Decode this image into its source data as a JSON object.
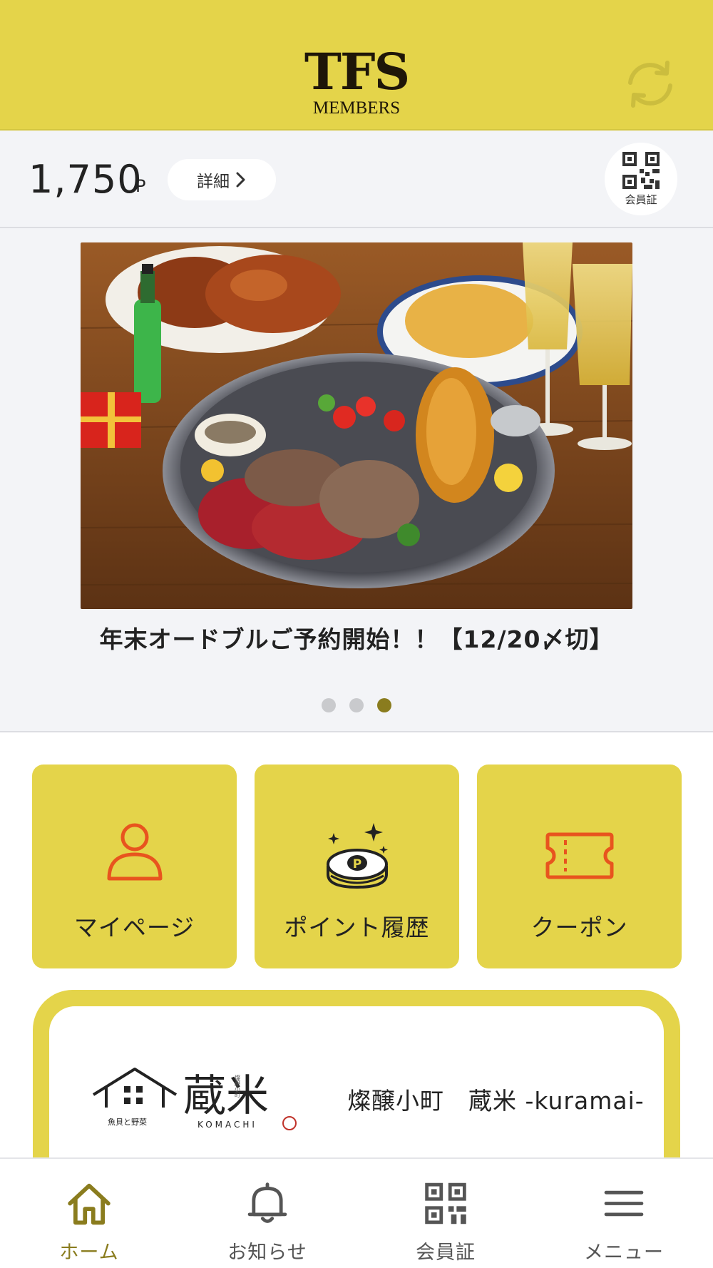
{
  "header": {
    "logo_main": "TFS",
    "logo_sub": "MEMBERS",
    "refresh_icon": "refresh-icon"
  },
  "points": {
    "value": "1,750",
    "unit": "P",
    "detail_label": "詳細",
    "qr_label": "会員証"
  },
  "banner": {
    "caption": "年末オードブルご予約開始！！【12/20〆切】",
    "slide_count": 3,
    "active_slide": 3
  },
  "tiles": [
    {
      "label": "マイページ",
      "icon": "person-icon"
    },
    {
      "label": "ポイント履歴",
      "icon": "point-coin-icon"
    },
    {
      "label": "クーポン",
      "icon": "ticket-icon"
    }
  ],
  "store": {
    "logo_text": "蔵米",
    "logo_small_left": "魚貝と野菜",
    "logo_small_right": "燦醸小町",
    "logo_roman": "KOMACHI",
    "name": "燦醸小町　蔵米 -kuramai-"
  },
  "nav": [
    {
      "label": "ホーム",
      "icon": "home-icon",
      "active": true
    },
    {
      "label": "お知らせ",
      "icon": "bell-icon",
      "active": false
    },
    {
      "label": "会員証",
      "icon": "qr-code-icon",
      "active": false
    },
    {
      "label": "メニュー",
      "icon": "hamburger-menu-icon",
      "active": false
    }
  ],
  "colors": {
    "brand_yellow": "#e4d44a",
    "accent_orange": "#e8541e",
    "active_nav": "#8a7c1e"
  }
}
